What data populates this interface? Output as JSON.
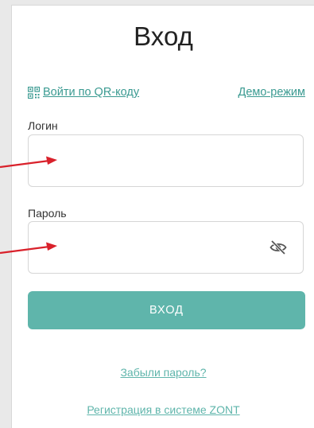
{
  "title": "Вход",
  "links": {
    "qr_login": "Войти по QR-коду",
    "demo_mode": "Демо-режим",
    "forgot_password": "Забыли пароль?",
    "register": "Регистрация в системе ZONT"
  },
  "form": {
    "login_label": "Логин",
    "login_value": "",
    "password_label": "Пароль",
    "password_value": "",
    "submit_label": "ВХОД"
  },
  "icons": {
    "qr": "qr-code-icon",
    "password_visibility": "eye-off-icon",
    "annotation": "red-arrow"
  },
  "colors": {
    "accent": "#5fb5ab",
    "link": "#3a9a91",
    "annotation_arrow": "#d9212b",
    "background": "#ffffff"
  }
}
